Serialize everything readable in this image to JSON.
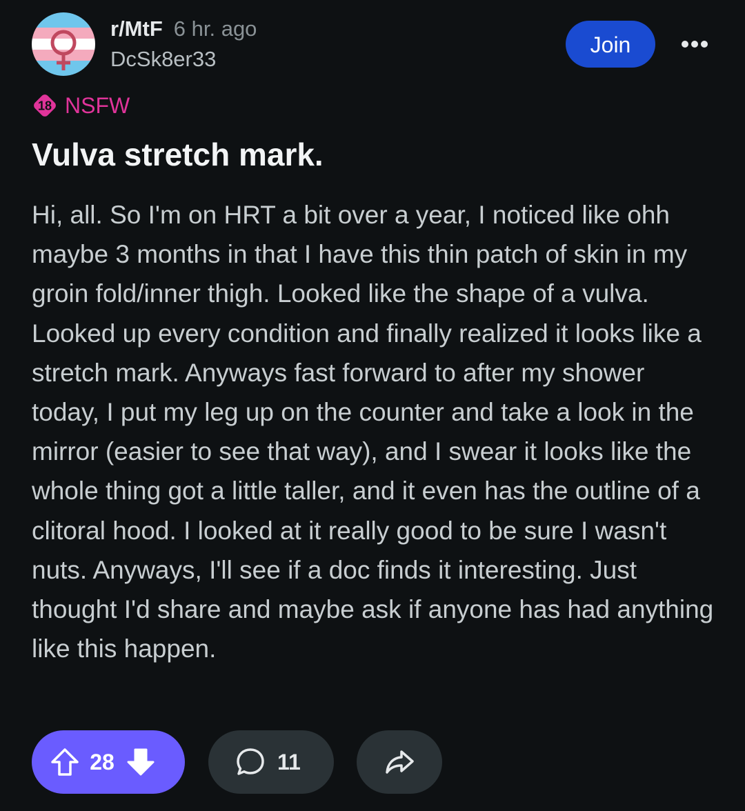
{
  "post": {
    "subreddit": "r/MtF",
    "time_ago": "6 hr. ago",
    "author": "DcSk8er33",
    "join_label": "Join",
    "nsfw_badge_number": "18",
    "nsfw_label": "NSFW",
    "title": "Vulva stretch mark.",
    "body": "Hi, all. So I'm on HRT a bit over a year, I noticed like ohh maybe 3 months in that I have this thin patch of skin in my groin fold/inner thigh. Looked like the shape of a vulva. Looked up every condition and finally realized it looks like a stretch mark. Anyways fast forward to after my shower today, I put my leg up on the counter and take a look in the mirror (easier to see that way), and I swear it looks like the whole thing got a little taller, and it even has the outline of a clitoral hood. I looked at it really good to be sure I wasn't nuts. Anyways, I'll see if a doc finds it interesting. Just thought I'd share and maybe ask if anyone has had anything like this happen."
  },
  "actions": {
    "upvote_count": "28",
    "comment_count": "11"
  },
  "icons": {
    "avatar": "trans-flag-venus-avatar",
    "more": "more-horizontal-icon",
    "upvote": "upvote-arrow-icon",
    "downvote": "downvote-arrow-icon",
    "comment": "comment-bubble-icon",
    "share": "share-arrow-icon"
  },
  "colors": {
    "background": "#0e1113",
    "join_button": "#1a4bd1",
    "nsfw": "#e0349a",
    "vote_pill": "#6a5cff",
    "secondary_pill": "#2a3236"
  }
}
